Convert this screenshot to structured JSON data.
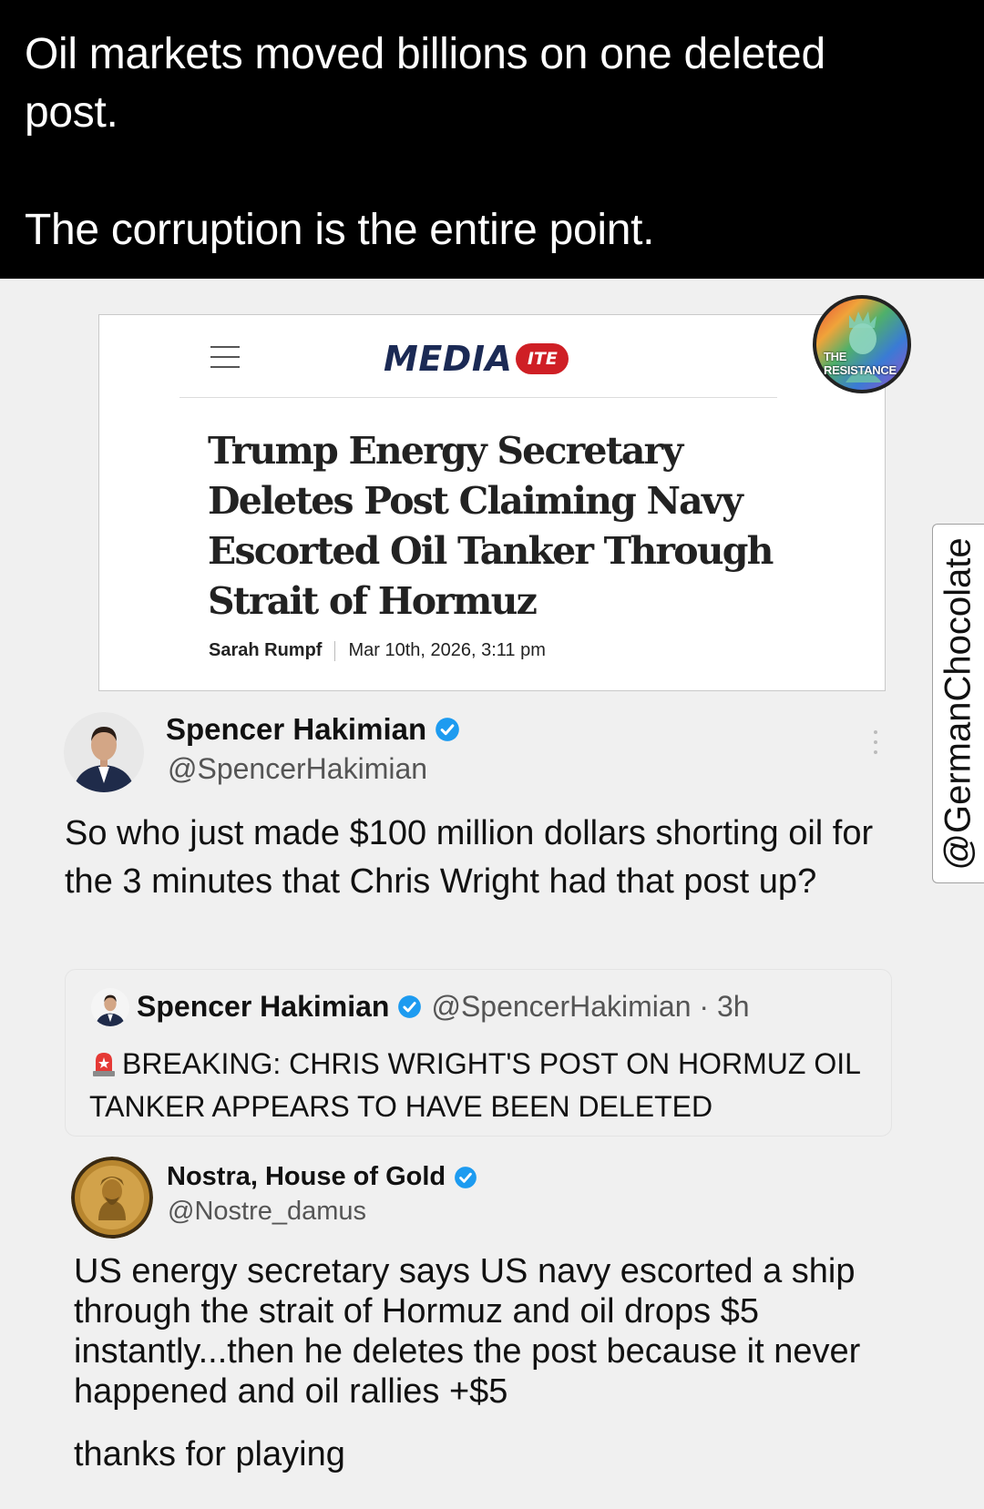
{
  "caption": {
    "line1": "Oil markets moved billions on one deleted",
    "line2": "post.",
    "line3": "The corruption is the entire point."
  },
  "article": {
    "logo_word": "MEDIA",
    "logo_badge": "ITE",
    "headline": "Trump Energy Secretary Deletes Post Claiming Navy Escorted Oil Tanker Through Strait of Hormuz",
    "author": "Sarah Rumpf",
    "date": "Mar 10th, 2026, 3:11 pm"
  },
  "badge": {
    "line1": "THE",
    "line2": "RESISTANCE"
  },
  "watermark": "@GermanChocolate",
  "tweet1": {
    "name": "Spencer Hakimian",
    "handle": "@SpencerHakimian",
    "body": "So who just made $100 million dollars shorting oil for the 3 minutes that Chris Wright had that post up?",
    "quote": {
      "name": "Spencer Hakimian",
      "handle_time": "@SpencerHakimian · 3h",
      "body": "BREAKING: CHRIS WRIGHT'S POST ON HORMUZ OIL TANKER APPEARS TO HAVE BEEN DELETED"
    }
  },
  "tweet2": {
    "name": "Nostra, House of Gold",
    "handle": "@Nostre_damus",
    "body": "US energy secretary says US navy escorted a ship through the strait of Hormuz and oil drops $5 instantly...then he deletes the post because it never happened and oil rallies +$5",
    "footer": "thanks for playing"
  },
  "colors": {
    "verified": "#1d9bf0",
    "media_navy": "#1b2a55",
    "media_red": "#cf1f25"
  },
  "icons": [
    "menu-icon",
    "verified-icon",
    "more-options-icon",
    "siren-emoji-icon"
  ]
}
